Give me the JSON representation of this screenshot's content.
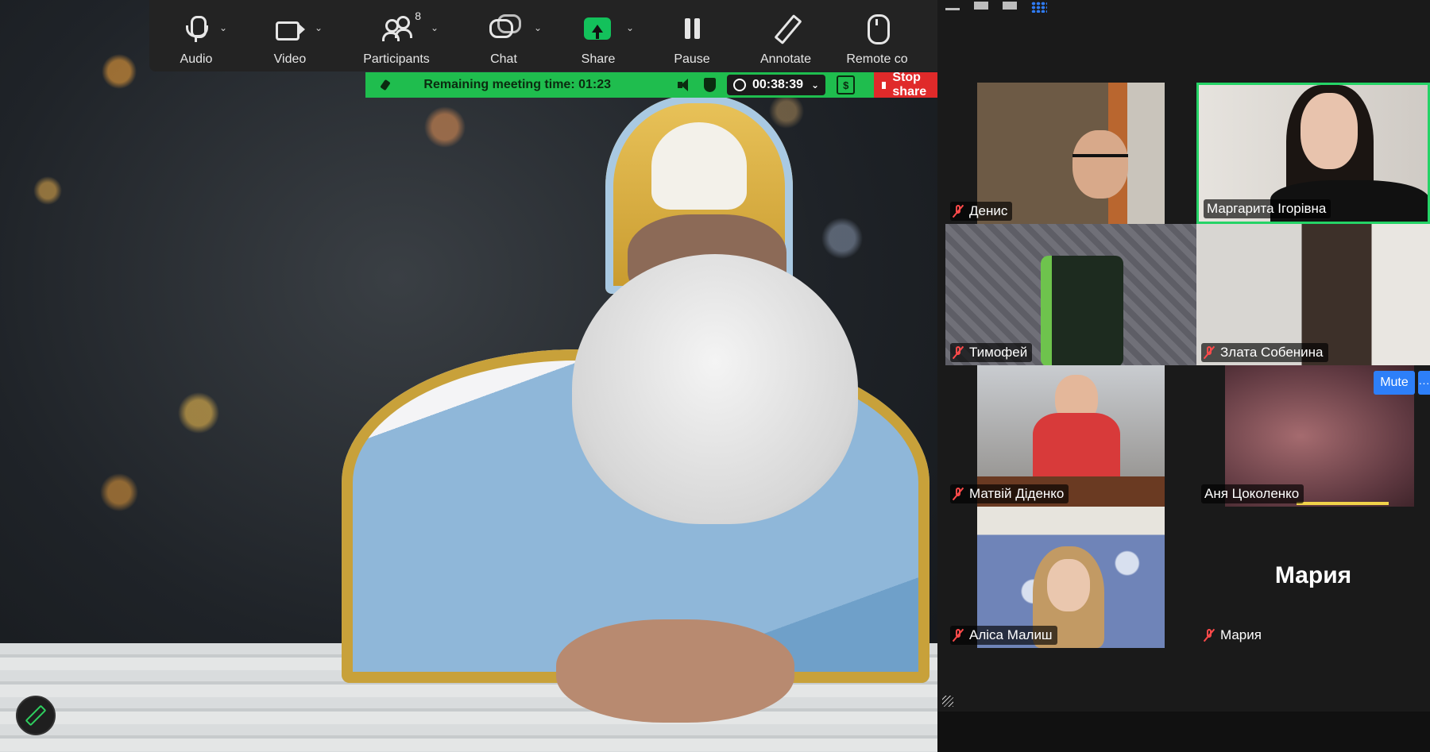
{
  "toolbar": {
    "audio": "Audio",
    "video": "Video",
    "participants": "Participants",
    "participants_count": "8",
    "chat": "Chat",
    "share": "Share",
    "pause": "Pause",
    "annotate": "Annotate",
    "remote": "Remote co"
  },
  "banner": {
    "remaining": "Remaining meeting time: 01:23",
    "timer": "00:38:39",
    "dollar": "$",
    "stop_share": "Stop share"
  },
  "gallery": {
    "tiles": [
      {
        "name": "Денис",
        "muted": true
      },
      {
        "name": "Маргарита Ігорівна",
        "muted": false,
        "active_speaker": true
      },
      {
        "name": "Тимофей",
        "muted": true
      },
      {
        "name": "Злата Собенина",
        "muted": true
      },
      {
        "name": "Матвій Діденко",
        "muted": true
      },
      {
        "name": "Аня Цоколенко",
        "muted": false
      },
      {
        "name": "Аліса Малиш",
        "muted": true
      },
      {
        "name": "Мария",
        "muted": true,
        "avatar_text": "Мария"
      }
    ],
    "mute_button": "Mute",
    "more_button": "···"
  },
  "colors": {
    "banner_green": "#1fbd4e",
    "stop_red": "#e02a2a",
    "share_green": "#13c15b",
    "active_border": "#25d366",
    "accent_blue": "#2d7ff9"
  }
}
